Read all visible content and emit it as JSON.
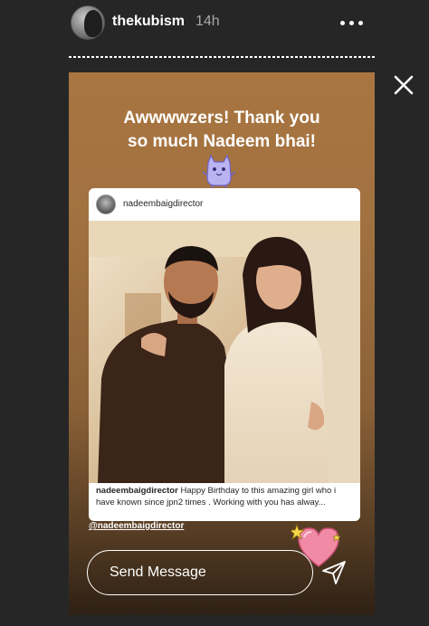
{
  "header": {
    "username": "thekubism",
    "time": "14h",
    "more_icon": "more-horizontal-icon",
    "close_icon": "close-icon"
  },
  "story": {
    "caption_line1": "Awwwwzers! Thank you",
    "caption_line2": "so much Nadeem bhai!",
    "sticker_top": "cat-sticker",
    "sticker_bottom": "heart-sticker",
    "shared_post": {
      "handle": "nadeembaigdirector",
      "caption_user": "nadeembaigdirector",
      "caption_text": "Happy Birthday to this amazing girl who i have known since jpn2 times . Working with you has alway..."
    },
    "mention": "@nadeembaigdirector"
  },
  "footer": {
    "send_placeholder": "Send Message",
    "send_icon": "paper-plane-icon"
  },
  "colors": {
    "background": "#262626",
    "story_gradient_top": "#a97541",
    "story_gradient_bottom": "#2e2015",
    "text": "#ffffff",
    "secondary_text": "#a8a8a8"
  }
}
